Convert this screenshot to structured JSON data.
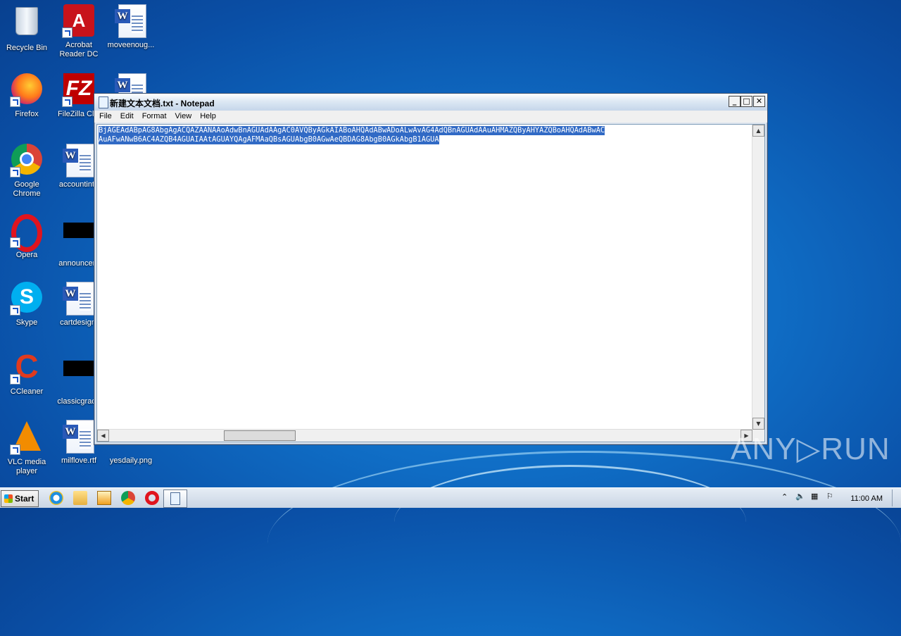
{
  "desktop": {
    "icons": [
      {
        "label": "Recycle Bin"
      },
      {
        "label": "Acrobat Reader DC"
      },
      {
        "label": "moveenoug..."
      },
      {
        "label": "Firefox"
      },
      {
        "label": "FileZilla Clie"
      },
      {
        "label": "Google Chrome"
      },
      {
        "label": "accountinte"
      },
      {
        "label": "Opera"
      },
      {
        "label": "announcem"
      },
      {
        "label": "Skype"
      },
      {
        "label": "cartdesign."
      },
      {
        "label": "CCleaner"
      },
      {
        "label": "classicgrade"
      },
      {
        "label": "VLC media player"
      },
      {
        "label": "milflove.rtf"
      },
      {
        "label": "yesdaily.png"
      }
    ]
  },
  "notepad": {
    "title": "新建文本文档.txt - Notepad",
    "menu": [
      "File",
      "Edit",
      "Format",
      "View",
      "Help"
    ],
    "content_lines": [
      "BjAGEAdABpAG8AbgAgACQAZAANAAoAdwBnAGUAdAAgAC0AVQByAGkAIABoAHQAdABwADoALwAvAG4AdQBnAGUAdAAuAHMAZQByAHYAZQBoAHQAdABwAC",
      "AuAFwANwB6AC4AZQB4AGUAIAAtAGUAYQAgAFMAaQBsAGUAbgB0AGwAeQBDAG8AbgB0AGkAbgB1AGUA"
    ],
    "window_buttons": {
      "minimize": "_",
      "maximize": "□",
      "close": "✕"
    }
  },
  "watermark": "ANY▷RUN",
  "taskbar": {
    "start_label": "Start",
    "clock": "11:00 AM"
  }
}
